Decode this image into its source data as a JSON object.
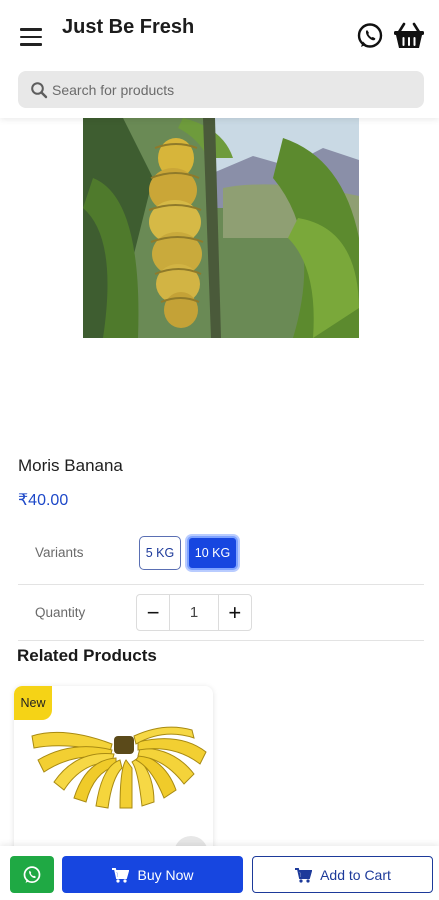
{
  "header": {
    "title": "Just Be Fresh",
    "menu_icon": "menu-icon",
    "whatsapp_icon": "whatsapp-icon",
    "cart_icon": "basket-icon"
  },
  "search": {
    "placeholder": "Search for products",
    "value": ""
  },
  "product": {
    "name": "Moris Banana",
    "price": "₹40.00",
    "image_alt": "banana-plant-photo"
  },
  "variants": {
    "label": "Variants",
    "options": [
      "5 KG",
      "10 KG"
    ],
    "selected": "10 KG"
  },
  "quantity": {
    "label": "Quantity",
    "minus": "−",
    "value": "1",
    "plus": "+"
  },
  "related": {
    "title": "Related Products",
    "items": [
      {
        "badge": "New",
        "image": "banana-bunch-photo"
      }
    ]
  },
  "bottom_bar": {
    "buy_now": "Buy Now",
    "add_to_cart": "Add to Cart"
  },
  "colors": {
    "primary": "#1746e0",
    "whatsapp": "#1fa944",
    "badge": "#f5d316",
    "price": "#1d48c8"
  }
}
